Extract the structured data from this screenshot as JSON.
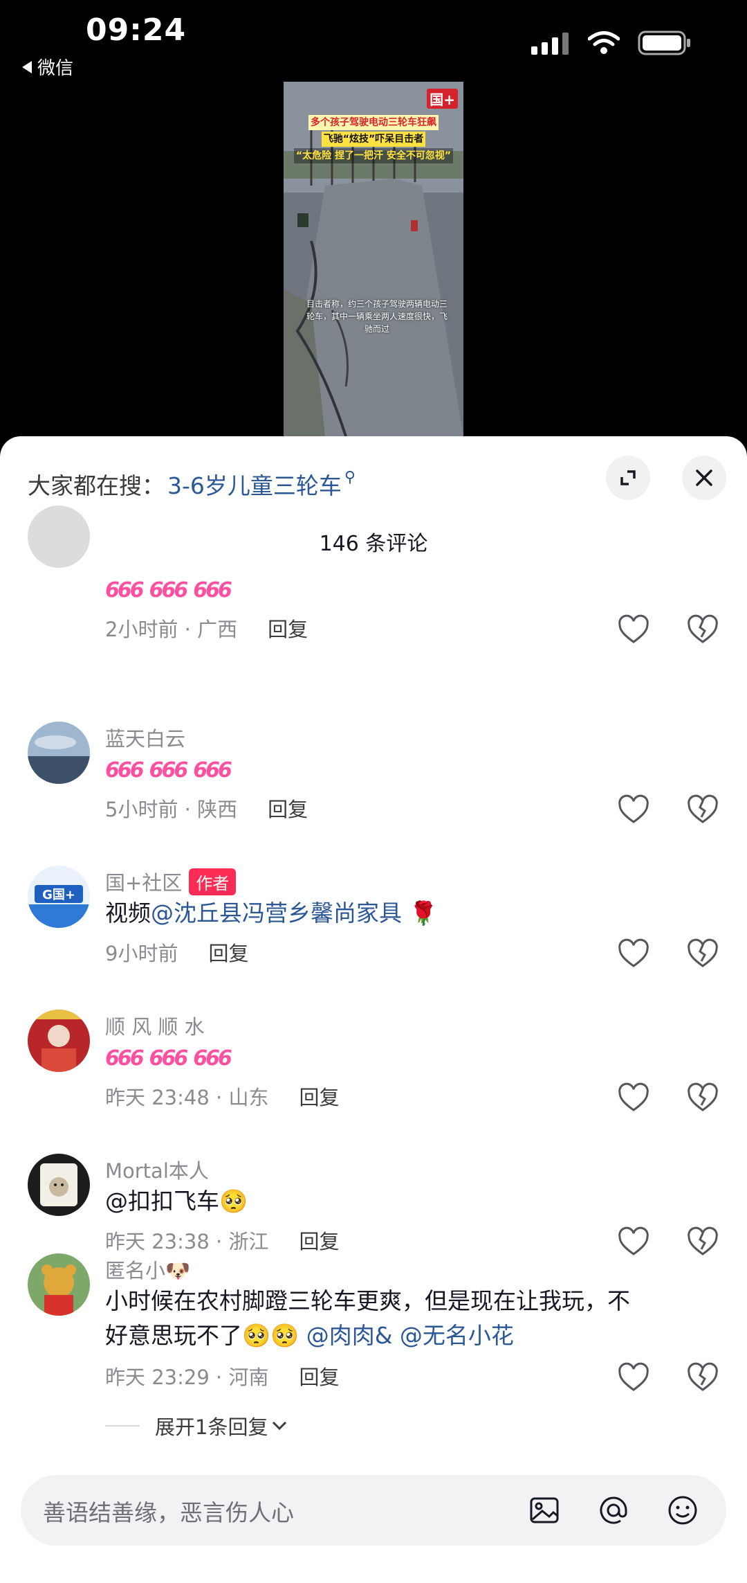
{
  "status_bar": {
    "time": "09:24",
    "back_label": "微信"
  },
  "video": {
    "logo": "国+",
    "headline1": "多个孩子驾驶电动三轮车狂飙",
    "headline2": "飞驰“炫技”吓呆目击者",
    "headline3": "“太危险 捏了一把汗 安全不可忽视”",
    "caption": "目击者称，约三个孩子驾驶两辆电动三轮车，其中一辆乘坐两人速度很快，飞驰而过"
  },
  "search": {
    "prefix": "大家都在搜：",
    "term": "3-6岁儿童三轮车"
  },
  "comments_count": "146 条评论",
  "comments": [
    {
      "name": "",
      "text": "",
      "emoji": [
        "666",
        "666",
        "666"
      ],
      "time": "2小时前 · 广西",
      "reply": "回复",
      "avatar": "partial-avatar"
    },
    {
      "name": "蓝天白云",
      "emoji": [
        "666",
        "666",
        "666"
      ],
      "time": "5小时前 · 陕西",
      "reply": "回复",
      "avatar": "sky-avatar"
    },
    {
      "name": "国+社区",
      "badge": "作者",
      "text": "视频",
      "mention": "@沈丘县冯营乡馨尚家具",
      "trail_emoji": "🌹",
      "time": "9小时前",
      "reply": "回复",
      "avatar": "logo-avatar"
    },
    {
      "name": "顺 风 顺 水",
      "emoji": [
        "666",
        "666",
        "666"
      ],
      "time": "昨天 23:48 · 山东",
      "reply": "回复",
      "avatar": "red-avatar"
    },
    {
      "name": "Mortal本人",
      "text": "@扣扣飞车",
      "trail_emoji": "🥺",
      "time": "昨天 23:38 · 浙江",
      "reply": "回复",
      "avatar": "cartoon-avatar"
    },
    {
      "name": "匿名小🐶",
      "text_line1": "小时候在农村脚蹬三轮车更爽，但是现在让我玩，不",
      "text_line2": "好意思玩不了",
      "emoji2": "🥺🥺",
      "mention1": "@肉肉&",
      "mention2": "@无名小花",
      "time": "昨天 23:29 · 河南",
      "reply": "回复",
      "avatar": "bear-avatar"
    }
  ],
  "expand_replies": "展开1条回复",
  "input": {
    "placeholder": "善语结善缘，恶言伤人心"
  },
  "colors": {
    "accent": "#fe2c55",
    "link": "#2b5797",
    "meta": "#8a8b91"
  }
}
